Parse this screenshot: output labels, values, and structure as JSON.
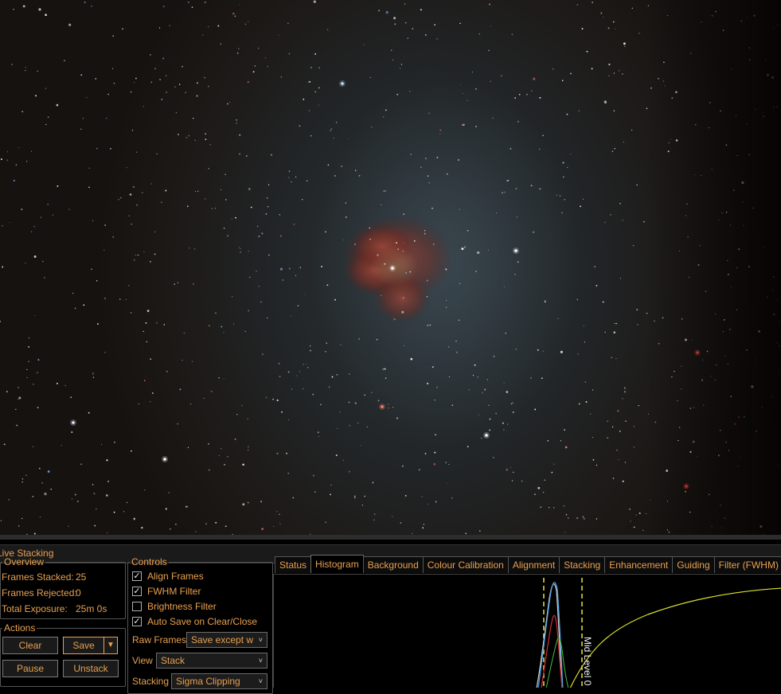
{
  "panel": {
    "title": "Live Stacking"
  },
  "overview": {
    "legend": "Overview",
    "frames_stacked_label": "Frames Stacked:",
    "frames_stacked_value": "25",
    "frames_rejected_label": "Frames Rejected:",
    "frames_rejected_value": "0",
    "total_exposure_label": "Total Exposure:",
    "total_exposure_value": "25m 0s"
  },
  "actions": {
    "legend": "Actions",
    "clear": "Clear",
    "save": "Save",
    "pause": "Pause",
    "unstack": "Unstack"
  },
  "controls": {
    "legend": "Controls",
    "checkboxes": [
      {
        "label": "Align Frames",
        "checked": true
      },
      {
        "label": "FWHM Filter",
        "checked": true
      },
      {
        "label": "Brightness Filter",
        "checked": false
      },
      {
        "label": "Auto Save on Clear/Close",
        "checked": true
      }
    ],
    "raw_frames_label": "Raw Frames",
    "raw_frames_value": "Save except w",
    "view_label": "View",
    "view_value": "Stack",
    "stacking_label": "Stacking",
    "stacking_value": "Sigma Clipping"
  },
  "tabs": [
    "Status",
    "Histogram",
    "Background",
    "Colour Calibration",
    "Alignment",
    "Stacking",
    "Enhancement",
    "Guiding",
    "Filter (FWHM)"
  ],
  "active_tab": "Histogram",
  "histogram": {
    "mid_level_label": "Mid Level  0"
  },
  "colors": {
    "accent": "#e8a050",
    "black_marker": "#f0e040",
    "curve": "#e0e030"
  }
}
